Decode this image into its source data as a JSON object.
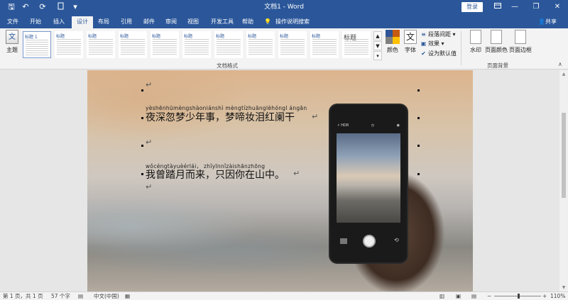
{
  "titlebar": {
    "title": "文档1 - Word",
    "login": "登录",
    "quick_access": {
      "save": "🖫",
      "undo": "↶",
      "redo": "⟳",
      "customize": "▾"
    }
  },
  "tabs": [
    {
      "label": "文件"
    },
    {
      "label": "开始"
    },
    {
      "label": "插入"
    },
    {
      "label": "设计"
    },
    {
      "label": "布局"
    },
    {
      "label": "引用"
    },
    {
      "label": "邮件"
    },
    {
      "label": "审阅"
    },
    {
      "label": "视图"
    },
    {
      "label": "开发工具"
    },
    {
      "label": "帮助"
    }
  ],
  "active_tab": "设计",
  "tell_me": "操作说明搜索",
  "share": "共享",
  "ribbon": {
    "theme_label": "主题",
    "gallery_items": [
      {
        "title": "标题 1"
      },
      {
        "title": "标题"
      },
      {
        "title": "标题"
      },
      {
        "title": "标题"
      },
      {
        "title": "标题"
      },
      {
        "title": "标题"
      },
      {
        "title": "标题"
      },
      {
        "title": "标题"
      },
      {
        "title": "标题"
      },
      {
        "title": "标题"
      },
      {
        "title": "标题"
      },
      {
        "title": "标题"
      }
    ],
    "colors_label": "颜色",
    "fonts_label": "字体",
    "fonts_icon": "文",
    "paragraph_spacing": "段落间距",
    "effects": "效果",
    "set_default": "设为默认值",
    "group_document_format": "文档格式",
    "watermark": "水印",
    "page_color": "页面颜色",
    "page_borders": "页面边框",
    "group_page_background": "页面背景",
    "swatch_colors": [
      "#2f5597",
      "#c55a11",
      "#7f7f7f",
      "#ffc000"
    ]
  },
  "document": {
    "line1_pinyin": "yèshēnhūmèngshàoniánshì   mèngtízhuānglèhóngl ángān",
    "line1_text": "夜深忽梦少年事，梦啼妆泪红阑干",
    "line2_pinyin": "wǒcéngtàyuèérlái，  zhǐyīnnǐzàishānzhōng",
    "line2_text": "我曾踏月而来，只因你在山中。",
    "para_mark": "↵"
  },
  "statusbar": {
    "page": "第 1 页，共 1 页",
    "words": "57 个字",
    "language": "中文(中国)",
    "zoom": "110%",
    "zoom_minus": "−",
    "zoom_plus": "+"
  }
}
